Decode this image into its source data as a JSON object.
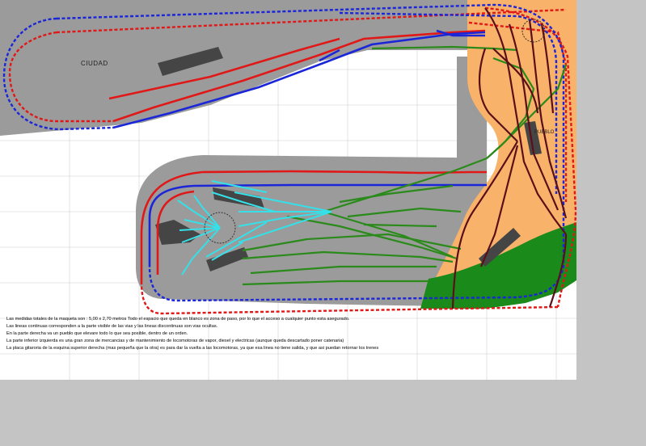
{
  "labels": {
    "city": "CIUDAD",
    "town": "PUEBLO"
  },
  "notes": [
    "Las medidas totales de la maqueta son :  5,00 x 2,70 metros  Todo el espacio que queda en blanco es zona de paso, por lo que el acceso a cualquier punto esta asegurado.",
    "Las lineas continuas corresponden a la parte visible de las vias y las lineas discontinuas son vias ocultas.",
    "En la parte derecha va un pueblo que elevare todo lo que sea posible, dentro de un orden.",
    "La parte inferior izquierda es una gran zona de mercancias y de mantenimiento de locomotoras de vapor, diesel y electricas (aunque queda descartado poner catenaria)",
    "La placa gitaroria de la esquina superior derecha (mas pequeña que la otra)  es para dar la vuelta a las locomotoras, ya que esa linea no tiene salida, y que asi puedan retornar los trenes"
  ],
  "colors": {
    "baseboard": "#9b9b9b",
    "town_area": "#f8b26a",
    "grass": "#1a8a1a",
    "line_red": "#e01818",
    "line_blue": "#1a26d8",
    "line_green": "#2a8a1a",
    "line_brown": "#5a0f1a",
    "line_cyan": "#35e0e8",
    "building": "#454545",
    "grid": "#d0d0d0"
  }
}
